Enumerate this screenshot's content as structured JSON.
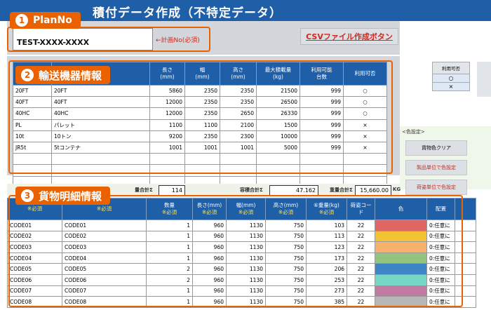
{
  "title": "積付データ作成（不特定データ）",
  "planno": {
    "badge_num": "1",
    "badge_label": "PlanNo",
    "field_label": "PlanNo",
    "value": "TEST-XXXX-XXXX",
    "note": "←計画No(必須)"
  },
  "csv_button": "CSVファイル作成ボタン",
  "transport": {
    "badge_num": "2",
    "badge_label": "輸送機器情報",
    "headers": [
      "長さ\n(mm)",
      "幅\n(mm)",
      "高さ\n(mm)",
      "最大積載量\n(kg)",
      "利用可能\n台数",
      "利用可否"
    ],
    "rows": [
      [
        "20FT",
        "20FT",
        "5860",
        "2350",
        "2350",
        "21500",
        "999",
        "○"
      ],
      [
        "40FT",
        "40FT",
        "12000",
        "2350",
        "2350",
        "26500",
        "999",
        "○"
      ],
      [
        "40HC",
        "40HC",
        "12000",
        "2350",
        "2650",
        "26330",
        "999",
        "○"
      ],
      [
        "PL",
        "パレット",
        "1100",
        "1100",
        "2100",
        "1500",
        "999",
        "×"
      ],
      [
        "10t",
        "10トン",
        "9200",
        "2350",
        "2300",
        "10000",
        "999",
        "×"
      ],
      [
        "JR5t",
        "5tコンテナ",
        "1001",
        "1001",
        "1001",
        "5000",
        "999",
        "×"
      ]
    ]
  },
  "side_panel": {
    "header": "利用可否",
    "values": [
      "○",
      "×"
    ],
    "color_label": "<色設定>",
    "btn_clear": "貨物色クリア",
    "btn_product": "製品単位で色設定",
    "btn_packing": "荷姿単位で色設定"
  },
  "totals": {
    "qty_label": "量合計Σ",
    "qty_value": "114",
    "volume_label": "容積合計Σ",
    "volume_value": "47.162",
    "weight_label": "重量合計Σ",
    "weight_value": "15,660.00",
    "weight_unit": "KG"
  },
  "cargo": {
    "badge_num": "3",
    "badge_label": "貨物明細情報",
    "required": "※必須",
    "headers": [
      "数量",
      "長さ(mm)",
      "幅(mm)",
      "高さ(mm)",
      "⑥重量(kg)",
      "荷姿コード",
      "色",
      "配置"
    ],
    "rows": [
      {
        "code": "CODE01",
        "name": "CODE01",
        "qty": "1",
        "len": "960",
        "wid": "1130",
        "hei": "750",
        "wt": "103",
        "pack": "22",
        "color": "#e06666",
        "place": "0:任意に"
      },
      {
        "code": "CODE02",
        "name": "CODE02",
        "qty": "1",
        "len": "960",
        "wid": "1130",
        "hei": "750",
        "wt": "113",
        "pack": "22",
        "color": "#f1c232",
        "place": "0:任意に"
      },
      {
        "code": "CODE03",
        "name": "CODE03",
        "qty": "1",
        "len": "960",
        "wid": "1130",
        "hei": "750",
        "wt": "123",
        "pack": "22",
        "color": "#f6b26b",
        "place": "0:任意に"
      },
      {
        "code": "CODE04",
        "name": "CODE04",
        "qty": "1",
        "len": "960",
        "wid": "1130",
        "hei": "750",
        "wt": "173",
        "pack": "22",
        "color": "#93c47d",
        "place": "0:任意に"
      },
      {
        "code": "CODE05",
        "name": "CODE05",
        "qty": "2",
        "len": "960",
        "wid": "1130",
        "hei": "750",
        "wt": "206",
        "pack": "22",
        "color": "#3d85c6",
        "place": "0:任意に"
      },
      {
        "code": "CODE06",
        "name": "CODE06",
        "qty": "2",
        "len": "960",
        "wid": "1130",
        "hei": "750",
        "wt": "253",
        "pack": "22",
        "color": "#76d7c4",
        "place": "0:任意に"
      },
      {
        "code": "CODE07",
        "name": "CODE07",
        "qty": "1",
        "len": "960",
        "wid": "1130",
        "hei": "750",
        "wt": "273",
        "pack": "22",
        "color": "#c27ba0",
        "place": "0:任意に"
      },
      {
        "code": "CODE08",
        "name": "CODE08",
        "qty": "1",
        "len": "960",
        "wid": "1130",
        "hei": "750",
        "wt": "385",
        "pack": "22",
        "color": "#b7b7b7",
        "place": "0:任意に"
      }
    ]
  }
}
